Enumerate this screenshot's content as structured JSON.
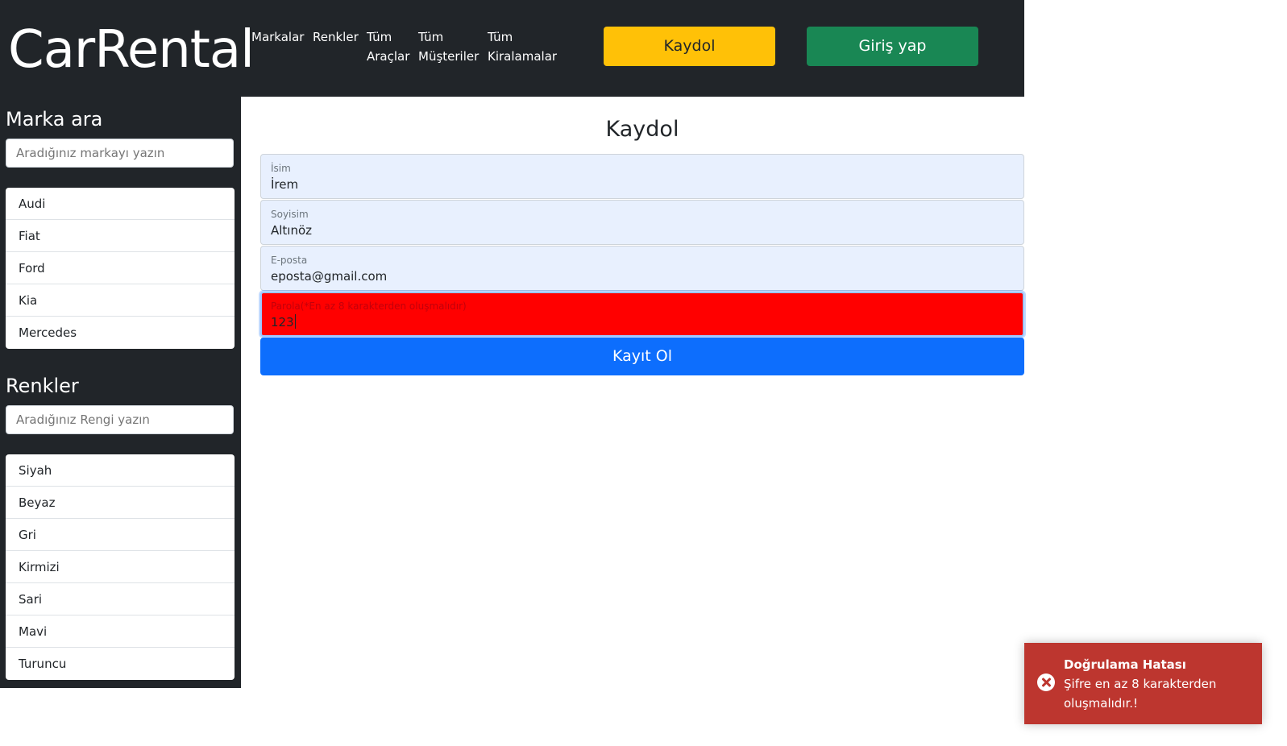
{
  "header": {
    "brand": "CarRental",
    "nav": [
      {
        "line1": "Markalar",
        "line2": ""
      },
      {
        "line1": "Renkler",
        "line2": ""
      },
      {
        "line1": "Tüm",
        "line2": "Araçlar"
      },
      {
        "line1": "Tüm",
        "line2": "Müşteriler"
      },
      {
        "line1": "Tüm",
        "line2": "Kiralamalar"
      }
    ],
    "register_button": "Kaydol",
    "login_button": "Giriş yap"
  },
  "sidebar": {
    "brands_heading": "Marka ara",
    "brands_search_placeholder": "Aradığınız markayı yazın",
    "brands": [
      "Audi",
      "Fiat",
      "Ford",
      "Kia",
      "Mercedes"
    ],
    "colors_heading": "Renkler",
    "colors_search_placeholder": "Aradığınız Rengi yazın",
    "colors": [
      "Siyah",
      "Beyaz",
      "Gri",
      "Kirmizi",
      "Sari",
      "Mavi",
      "Turuncu"
    ]
  },
  "form": {
    "title": "Kaydol",
    "fields": [
      {
        "label": "İsim",
        "value": "İrem"
      },
      {
        "label": "Soyisim",
        "value": "Altınöz"
      },
      {
        "label": "E-posta",
        "value": "eposta@gmail.com"
      },
      {
        "label": "Parola(*En az 8 karakterden oluşmalıdır)",
        "value": "123"
      }
    ],
    "submit": "Kayıt Ol"
  },
  "toast": {
    "title": "Doğrulama Hatası",
    "message": "Şifre en az 8 karakterden oluşmalıdır.!"
  },
  "colors": {
    "dark": "#212529",
    "warning": "#ffc107",
    "success": "#198754",
    "primary": "#0d6efd",
    "error_field": "#ff0000",
    "toast": "#bd362f"
  }
}
